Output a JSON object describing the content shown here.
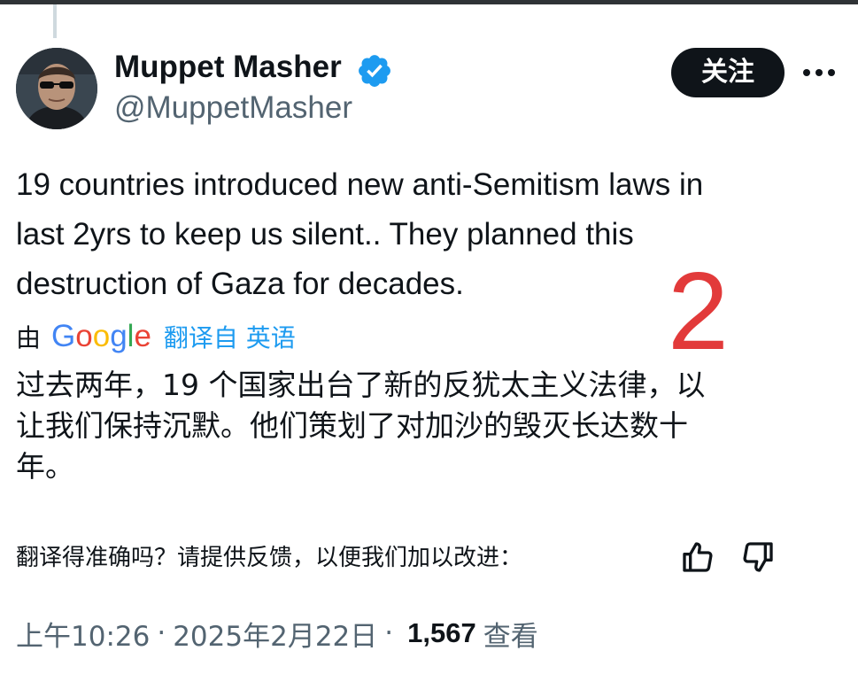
{
  "author": {
    "display_name": "Muppet Masher",
    "handle": "@MuppetMasher"
  },
  "follow_label": "关注",
  "tweet": {
    "text": "19 countries introduced new anti-Semitism laws in\nlast 2yrs to keep us silent.. They planned this\ndestruction of Gaza for decades."
  },
  "overlay_number": "2",
  "translation": {
    "by_label": "由",
    "google_letters": [
      {
        "ch": "G",
        "color": "#4285f4"
      },
      {
        "ch": "o",
        "color": "#ea4335"
      },
      {
        "ch": "o",
        "color": "#fbbc05"
      },
      {
        "ch": "g",
        "color": "#4285f4"
      },
      {
        "ch": "l",
        "color": "#34a853"
      },
      {
        "ch": "e",
        "color": "#ea4335"
      }
    ],
    "link_label": "翻译自 英语",
    "text": "过去两年，19 个国家出台了新的反犹太主义法律，以\n让我们保持沉默。他们策划了对加沙的毁灭长达数十\n年。",
    "feedback_question": "翻译得准确吗？请提供反馈，以便我们加以改进："
  },
  "meta": {
    "time": "上午10:26",
    "separator": "·",
    "date": "2025年2月22日",
    "views_count": "1,567",
    "views_label": "查看"
  },
  "colors": {
    "text": "#0f1419",
    "secondary": "#536471",
    "link": "#1d9bf0",
    "verified": "#1d9bf0",
    "overlay": "#e23a3a"
  },
  "icons": {
    "verified": "verified-badge-icon",
    "more": "more-horizontal-icon",
    "thumbs_up": "thumbs-up-icon",
    "thumbs_down": "thumbs-down-icon"
  }
}
